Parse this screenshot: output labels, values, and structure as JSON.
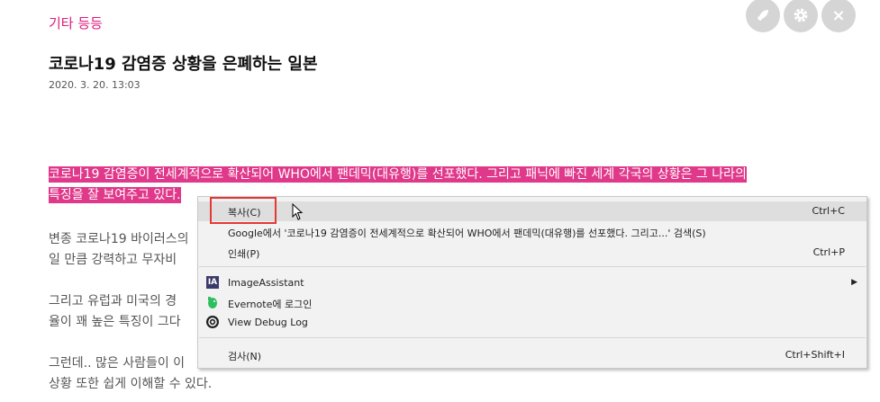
{
  "post": {
    "category": "기타 등등",
    "title": "코로나19 감염증 상황을 은폐하는 일본",
    "date": "2020. 3. 20. 13:03"
  },
  "body": {
    "p1_line1": "코로나19 감염증이 전세계적으로 확산되어 WHO에서 팬데믹(대유행)를 선포했다. 그리고 패닉에 빠진 세계 각국의 상황은 그 나라의",
    "p1_line2": "특징을 잘 보여주고 있다.",
    "p2_line1": "변종 코로나19 바이러스의",
    "p2_line2": "일 만큼 강력하고 무자비",
    "p3_line1": "그리고 유럽과 미국의 경",
    "p3_line2": "율이 꽤 높은 특징이 그다",
    "p4_line1": "그런데.. 많은 사람들이 이",
    "p4_line2": "상황 또한 쉽게 이해할 수 있다."
  },
  "top_buttons": [
    {
      "icon": "rocket-icon"
    },
    {
      "icon": "gear-icon"
    },
    {
      "icon": "close-icon",
      "glyph": "×"
    }
  ],
  "context_menu": {
    "copy": {
      "label": "복사(C)",
      "shortcut": "Ctrl+C"
    },
    "search_google": {
      "label": "Google에서 '코로나19 감염증이 전세계적으로 확산되어 WHO에서 팬데믹(대유행)를 선포했다. 그리고...' 검색(S)"
    },
    "print": {
      "label": "인쇄(P)",
      "shortcut": "Ctrl+P"
    },
    "image_assistant": {
      "label": "ImageAssistant",
      "icon_text": "IA"
    },
    "evernote": {
      "label": "Evernote에 로그인"
    },
    "debug_log": {
      "label": "View Debug Log"
    },
    "inspect": {
      "label": "검사(N)",
      "shortcut": "Ctrl+Shift+I"
    }
  },
  "colors": {
    "accent": "#e0197d",
    "highlight": "#e0388a",
    "menu_bg": "#f2f2f2",
    "annotation_red": "#e53935"
  }
}
